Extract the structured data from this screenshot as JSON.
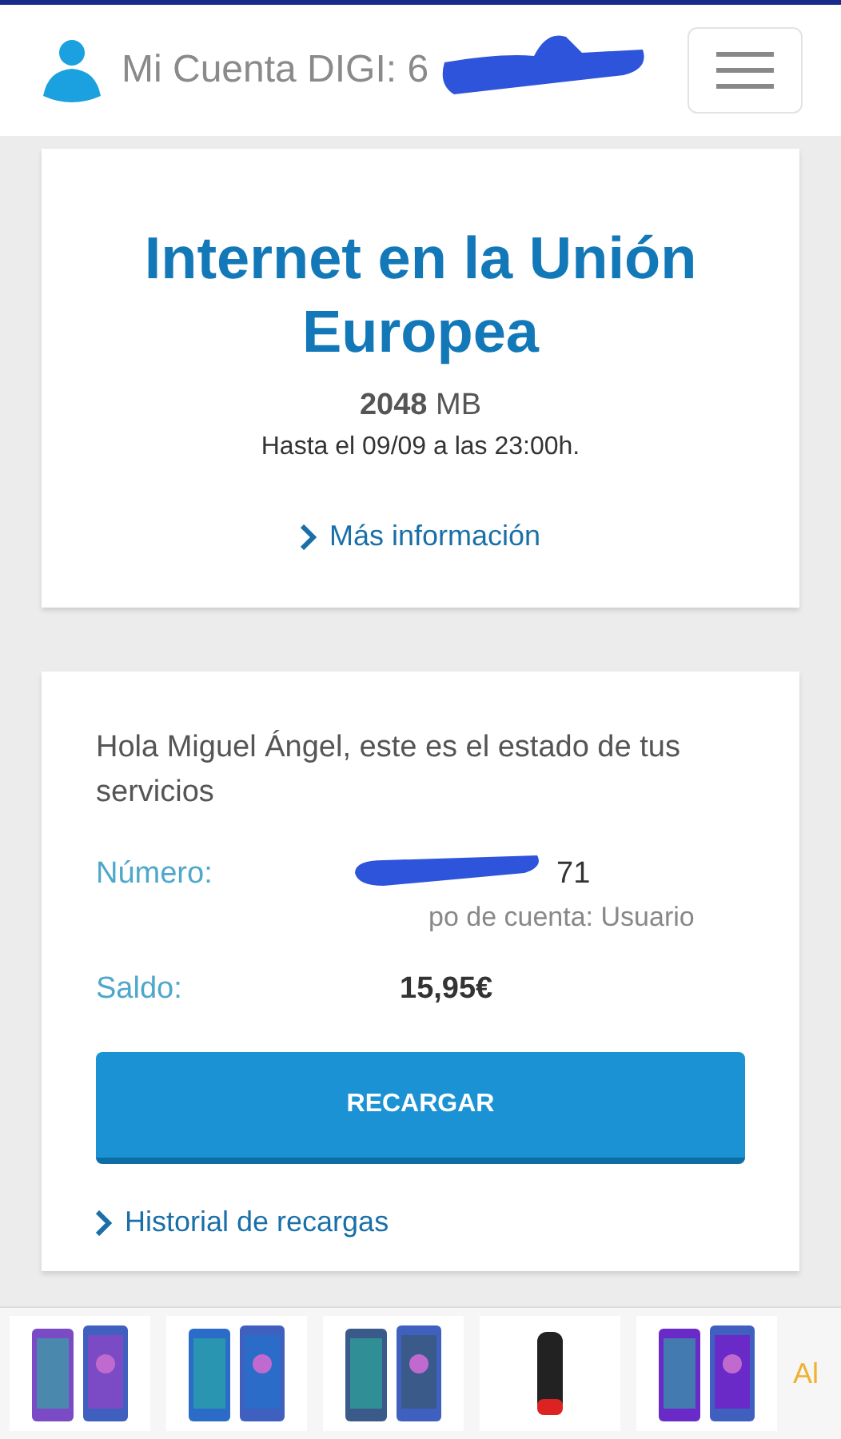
{
  "header": {
    "title": "Mi Cuenta DIGI: 6",
    "redacted": true
  },
  "promo": {
    "title": "Internet en la Unión Europea",
    "amount": "2048",
    "unit": "MB",
    "validity": "Hasta el 09/09 a las 23:00h.",
    "link": "Más información"
  },
  "account": {
    "greeting": "Hola Miguel Ángel, este es el estado de tus servicios",
    "rows": [
      {
        "label": "Número:",
        "value": "71",
        "note": "po de cuenta: Usuario",
        "redacted": true
      },
      {
        "label": "Saldo:",
        "value": "15,95€"
      }
    ],
    "button": "RECARGAR",
    "link": "Historial de recargas"
  },
  "banner": {
    "tail": "Al"
  }
}
